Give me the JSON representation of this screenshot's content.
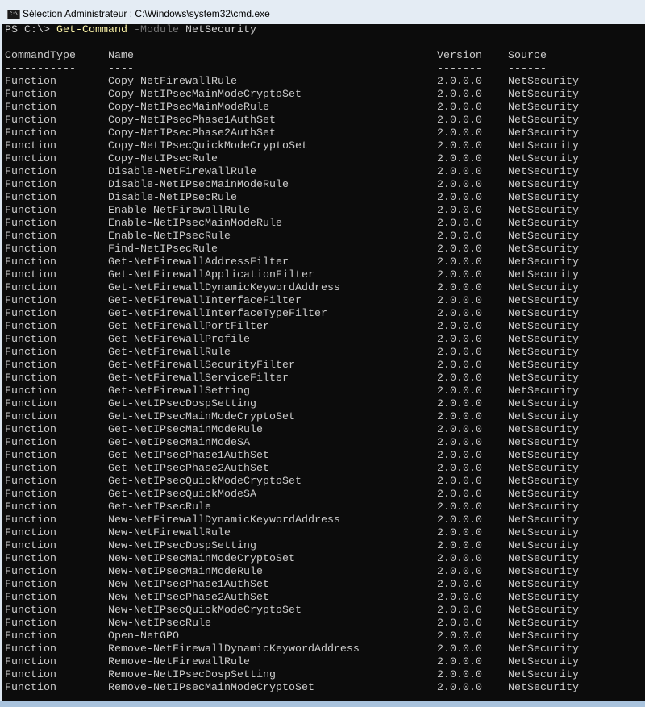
{
  "window": {
    "title": "Sélection Administrateur : C:\\Windows\\system32\\cmd.exe",
    "icon": "cmd-icon",
    "icon_text": "C:\\"
  },
  "prompt": {
    "ps": "PS C:\\> ",
    "command": "Get-Command",
    "param": " -Module",
    "value": " NetSecurity"
  },
  "headers": [
    "CommandType",
    "Name",
    "Version",
    "Source"
  ],
  "dashes": [
    "-----------",
    "----",
    "-------",
    "------"
  ],
  "row_defaults": {
    "type": "Function",
    "version": "2.0.0.0",
    "source": "NetSecurity"
  },
  "rows": [
    "Copy-NetFirewallRule",
    "Copy-NetIPsecMainModeCryptoSet",
    "Copy-NetIPsecMainModeRule",
    "Copy-NetIPsecPhase1AuthSet",
    "Copy-NetIPsecPhase2AuthSet",
    "Copy-NetIPsecQuickModeCryptoSet",
    "Copy-NetIPsecRule",
    "Disable-NetFirewallRule",
    "Disable-NetIPsecMainModeRule",
    "Disable-NetIPsecRule",
    "Enable-NetFirewallRule",
    "Enable-NetIPsecMainModeRule",
    "Enable-NetIPsecRule",
    "Find-NetIPsecRule",
    "Get-NetFirewallAddressFilter",
    "Get-NetFirewallApplicationFilter",
    "Get-NetFirewallDynamicKeywordAddress",
    "Get-NetFirewallInterfaceFilter",
    "Get-NetFirewallInterfaceTypeFilter",
    "Get-NetFirewallPortFilter",
    "Get-NetFirewallProfile",
    "Get-NetFirewallRule",
    "Get-NetFirewallSecurityFilter",
    "Get-NetFirewallServiceFilter",
    "Get-NetFirewallSetting",
    "Get-NetIPsecDospSetting",
    "Get-NetIPsecMainModeCryptoSet",
    "Get-NetIPsecMainModeRule",
    "Get-NetIPsecMainModeSA",
    "Get-NetIPsecPhase1AuthSet",
    "Get-NetIPsecPhase2AuthSet",
    "Get-NetIPsecQuickModeCryptoSet",
    "Get-NetIPsecQuickModeSA",
    "Get-NetIPsecRule",
    "New-NetFirewallDynamicKeywordAddress",
    "New-NetFirewallRule",
    "New-NetIPsecDospSetting",
    "New-NetIPsecMainModeCryptoSet",
    "New-NetIPsecMainModeRule",
    "New-NetIPsecPhase1AuthSet",
    "New-NetIPsecPhase2AuthSet",
    "New-NetIPsecQuickModeCryptoSet",
    "New-NetIPsecRule",
    "Open-NetGPO",
    "Remove-NetFirewallDynamicKeywordAddress",
    "Remove-NetFirewallRule",
    "Remove-NetIPsecDospSetting",
    "Remove-NetIPsecMainModeCryptoSet"
  ]
}
